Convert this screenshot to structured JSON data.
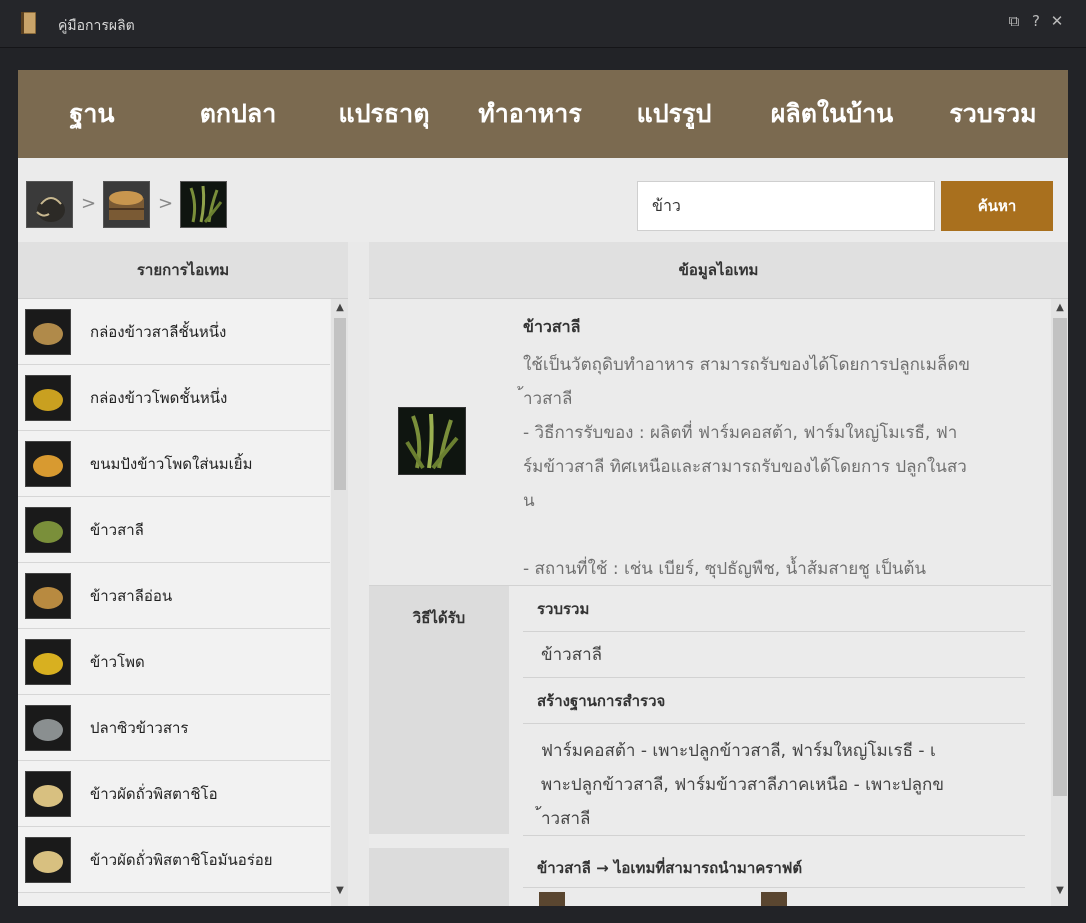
{
  "window": {
    "title": "คู่มือการผลิต",
    "controls": [
      "⧉",
      "?",
      "✕"
    ]
  },
  "tabs": [
    "ฐาน",
    "ตกปลา",
    "แปรธาตุ",
    "ทำอาหาร",
    "แปรรูป",
    "ผลิตในบ้าน",
    "รวบรวม"
  ],
  "breadcrumb": {
    "separator": ">",
    "items": [
      {
        "icon": "sack-icon"
      },
      {
        "icon": "grain-crate-icon"
      },
      {
        "icon": "rice-plant-icon"
      }
    ]
  },
  "search": {
    "value": "ข้าว",
    "button_label": "ค้นหา"
  },
  "item_list": {
    "header": "รายการไอเทม",
    "items": [
      {
        "label": "กล่องข้าวสาลีชั้นหนึ่ง",
        "icon": "wheat-crate-icon",
        "color": "#b08a4a"
      },
      {
        "label": "กล่องข้าวโพดชั้นหนึ่ง",
        "icon": "corn-crate-icon",
        "color": "#c9a020"
      },
      {
        "label": "ขนมปังข้าวโพดใส่นมเยิ้ม",
        "icon": "corn-bread-icon",
        "color": "#d89a30"
      },
      {
        "label": "ข้าวสาลี",
        "icon": "wheat-plant-icon",
        "color": "#7a8f3a"
      },
      {
        "label": "ข้าวสาลีอ่อน",
        "icon": "young-wheat-icon",
        "color": "#b88a40"
      },
      {
        "label": "ข้าวโพด",
        "icon": "corn-icon",
        "color": "#d8b020"
      },
      {
        "label": "ปลาซิวข้าวสาร",
        "icon": "fish-icon",
        "color": "#8a8f90"
      },
      {
        "label": "ข้าวผัดถั่วพิสตาชิโอ",
        "icon": "fried-rice-icon",
        "color": "#d8c080"
      },
      {
        "label": "ข้าวผัดถั่วพิสตาชิโอมันอร่อย",
        "icon": "tasty-fried-rice-icon",
        "color": "#d8c080"
      }
    ]
  },
  "item_info": {
    "header": "ข้อมูลไอเทม",
    "name": "ข้าวสาลี",
    "icon": "wheat-plant-icon",
    "description_lines": [
      "ใช้เป็นวัตถุดิบทำอาหาร สามารถรับของได้โดยการปลูกเมล็ดข",
      "้าวสาลี",
      "- วิธีการรับของ : ผลิตที่ ฟาร์มคอสต้า, ฟาร์มใหญ่โมเรธี, ฟา",
      "ร์มข้าวสาลี ทิศเหนือและสามารถรับของได้โดยการ ปลูกในสว",
      "น",
      "",
      "- สถานที่ใช้ : เช่น เบียร์, ซุปธัญพืช, น้ำส้มสายชู เป็นต้น"
    ]
  },
  "obtain": {
    "label": "วิธีได้รับ",
    "gather_title": "รวบรวม",
    "gather_value": "ข้าวสาลี",
    "build_title": "สร้างฐานการสำรวจ",
    "build_lines": [
      "ฟาร์มคอสต้า - เพาะปลูกข้าวสาลี, ฟาร์มใหญ่โมเรธี - เ",
      "พาะปลูกข้าวสาลี, ฟาร์มข้าวสาลีภาคเหนือ - เพาะปลูกข",
      "้าวสาลี"
    ]
  },
  "craft": {
    "title": "ข้าวสาลี → ไอเทมที่สามารถนำมาคราฟต์"
  },
  "colors": {
    "tab_bar": "#7b6a50",
    "search_button": "#a9701e",
    "wheat_green": "#7a8f3a"
  }
}
